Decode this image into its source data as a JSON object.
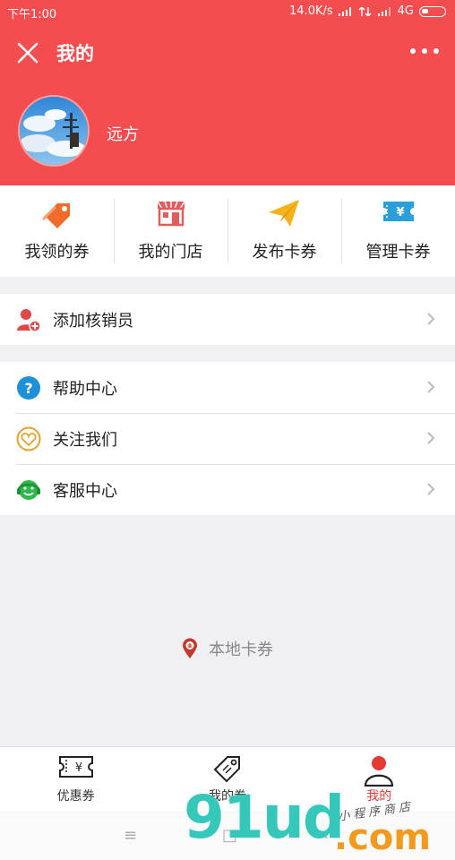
{
  "status": {
    "time": "下午1:00",
    "speed": "14.0K/s",
    "network": "4G"
  },
  "header": {
    "title": "我的",
    "username": "远方"
  },
  "actions": [
    {
      "label": "我领的券",
      "icon": "coupon-tag-icon"
    },
    {
      "label": "我的门店",
      "icon": "store-icon"
    },
    {
      "label": "发布卡券",
      "icon": "paper-plane-icon"
    },
    {
      "label": "管理卡券",
      "icon": "yuan-ticket-icon"
    }
  ],
  "group1": [
    {
      "label": "添加核销员",
      "icon": "add-user-icon"
    }
  ],
  "group2": [
    {
      "label": "帮助中心",
      "icon": "help-icon"
    },
    {
      "label": "关注我们",
      "icon": "heart-icon"
    },
    {
      "label": "客服中心",
      "icon": "customer-service-icon"
    }
  ],
  "brand": {
    "text": "本地卡券",
    "icon": "location-pin-icon"
  },
  "tabs": [
    {
      "label": "优惠券",
      "icon": "coupon-icon",
      "active": false
    },
    {
      "label": "我的券",
      "icon": "tag-icon",
      "active": false
    },
    {
      "label": "我的",
      "icon": "user-icon",
      "active": true
    }
  ],
  "watermark": {
    "big": "91ud",
    "domain": ".com",
    "sub": "小程序商店"
  },
  "colors": {
    "accent": "#f44d4f",
    "active_tab": "#e53935",
    "watermark_teal": "#35c8ba",
    "watermark_orange": "#f39a1c"
  }
}
